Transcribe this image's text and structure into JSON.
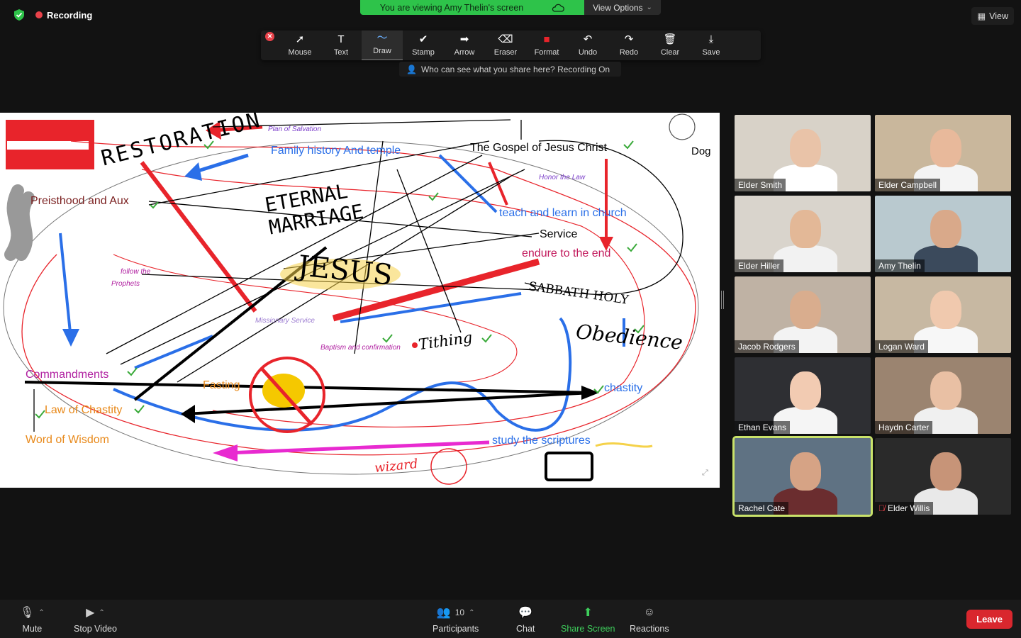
{
  "status": {
    "recording": "Recording"
  },
  "banner": {
    "viewing": "You are viewing Amy Thelin's screen",
    "view_options": "View Options"
  },
  "view_button": "View",
  "toolbar": {
    "tools": [
      {
        "label": "Mouse",
        "icon": "mouse-pointer-icon",
        "glyph": "➚"
      },
      {
        "label": "Text",
        "icon": "text-icon",
        "glyph": "T"
      },
      {
        "label": "Draw",
        "icon": "draw-icon",
        "glyph": "〜",
        "active": true
      },
      {
        "label": "Stamp",
        "icon": "stamp-icon",
        "glyph": "✔"
      },
      {
        "label": "Arrow",
        "icon": "arrow-icon",
        "glyph": "➡"
      },
      {
        "label": "Eraser",
        "icon": "eraser-icon",
        "glyph": "⌫"
      },
      {
        "label": "Format",
        "icon": "format-icon",
        "glyph": "■"
      },
      {
        "label": "Undo",
        "icon": "undo-icon",
        "glyph": "↶"
      },
      {
        "label": "Redo",
        "icon": "redo-icon",
        "glyph": "↷"
      },
      {
        "label": "Clear",
        "icon": "trash-icon",
        "glyph": "🗑"
      },
      {
        "label": "Save",
        "icon": "save-icon",
        "glyph": "⤓"
      }
    ],
    "format_color": "#e8242b",
    "who_can_see": "Who can see what you share here? Recording On"
  },
  "whiteboard": {
    "plan_of_salvation": "Plan of Salvation",
    "family_history": "Family history And temple",
    "gospel": "The Gospel of Jesus Christ",
    "dog": "Dog",
    "honor_law": "Honor the Law",
    "priesthood": "Preisthood and Aux",
    "teach_learn": "teach and learn in church",
    "service": "Service",
    "endure": "endure to the end",
    "follow_prophets_1": "follow the",
    "follow_prophets_2": "Prophets",
    "missionary": "Missionary Service",
    "baptism": "Baptism and confirmation",
    "commandments": "Commandments",
    "fasting": "Fasting",
    "chastity": "chastity",
    "law_chastity": "Law of Chastity",
    "word_wisdom": "Word of Wisdom",
    "study": "study the scriptures",
    "restoration": "RESTORATION",
    "eternal_marriage": "ETERNAL MARRIAGE",
    "jesus": "JESUS",
    "sabbath": "SABBATH HOLY",
    "obedience": "Obedience",
    "tithing": "Tithing",
    "wizard": "wizard"
  },
  "participants": [
    {
      "name": "Elder Smith",
      "bg": "#d8d2c8",
      "skin": "#e9c3a8",
      "shirt": "#ffffff"
    },
    {
      "name": "Elder Campbell",
      "bg": "#c9b79c",
      "skin": "#e8b99b",
      "shirt": "#f4f4f4"
    },
    {
      "name": "Elder Hiller",
      "bg": "#d9d4cc",
      "skin": "#e3b897",
      "shirt": "#f2f2f2"
    },
    {
      "name": "Amy Thelin",
      "bg": "#b9c9cf",
      "skin": "#d9a98a",
      "shirt": "#3b4a5c"
    },
    {
      "name": "Jacob Rodgers",
      "bg": "#bfb2a4",
      "skin": "#d9ad8e",
      "shirt": "#f3f3f3"
    },
    {
      "name": "Logan Ward",
      "bg": "#c7b8a2",
      "skin": "#f0c9ae",
      "shirt": "#f7f7f7"
    },
    {
      "name": "Ethan Evans",
      "bg": "#2e2f33",
      "skin": "#f2cbb2",
      "shirt": "#f5f5f5"
    },
    {
      "name": "Haydn Carter",
      "bg": "#9b8470",
      "skin": "#e9c0a4",
      "shirt": "#f0f0f0"
    },
    {
      "name": "Rachel Cate",
      "bg": "#5f7283",
      "skin": "#d6a385",
      "shirt": "#6b2d2f",
      "speaking": true
    },
    {
      "name": "Elder Willis",
      "bg": "#2a2a2a",
      "skin": "#c79478",
      "shirt": "#e9e9e9",
      "muted": true
    }
  ],
  "bottom_bar": {
    "mute": "Mute",
    "stop_video": "Stop Video",
    "participants": "Participants",
    "participants_count": "10",
    "chat": "Chat",
    "share_screen": "Share Screen",
    "reactions": "Reactions",
    "leave": "Leave"
  }
}
